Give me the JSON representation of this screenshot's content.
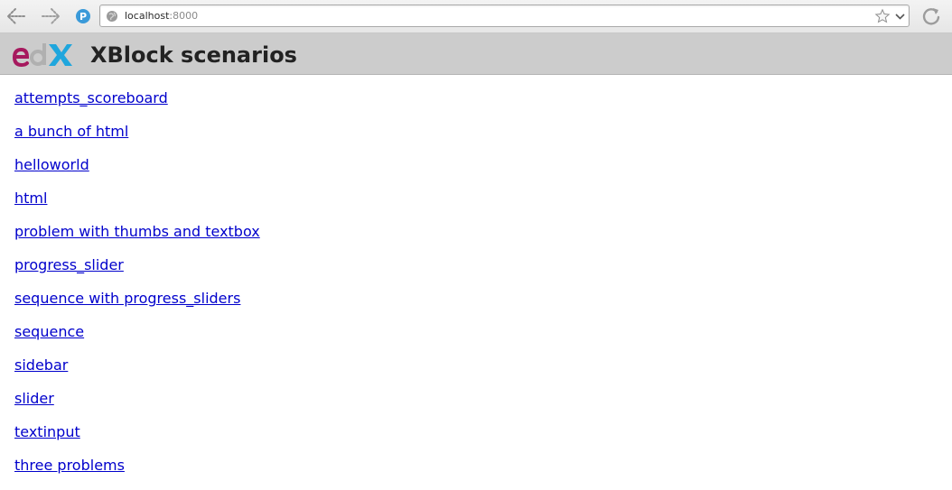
{
  "browser": {
    "url_host": "localhost",
    "url_port": ":8000",
    "icons": {
      "back": "back-arrow-icon",
      "forward": "forward-arrow-icon",
      "extension": "extension-p-icon",
      "extension_letter": "P",
      "site": "globe-icon",
      "bookmark": "star-icon",
      "dropdown": "chevron-down-icon",
      "reload": "reload-icon"
    }
  },
  "header": {
    "logo_name": "edX",
    "title": "XBlock scenarios"
  },
  "scenarios": [
    {
      "label": "attempts_scoreboard"
    },
    {
      "label": "a bunch of html"
    },
    {
      "label": "helloworld"
    },
    {
      "label": "html"
    },
    {
      "label": "problem with thumbs and textbox"
    },
    {
      "label": "progress_slider"
    },
    {
      "label": "sequence with progress_sliders"
    },
    {
      "label": "sequence"
    },
    {
      "label": "sidebar"
    },
    {
      "label": "slider"
    },
    {
      "label": "textinput"
    },
    {
      "label": "three problems"
    }
  ],
  "colors": {
    "header_bg": "#cccccc",
    "link": "#0000cc",
    "edx_magenta": "#a6195e",
    "edx_blue": "#1fa6dd",
    "extension_blue": "#3a9ad9"
  }
}
